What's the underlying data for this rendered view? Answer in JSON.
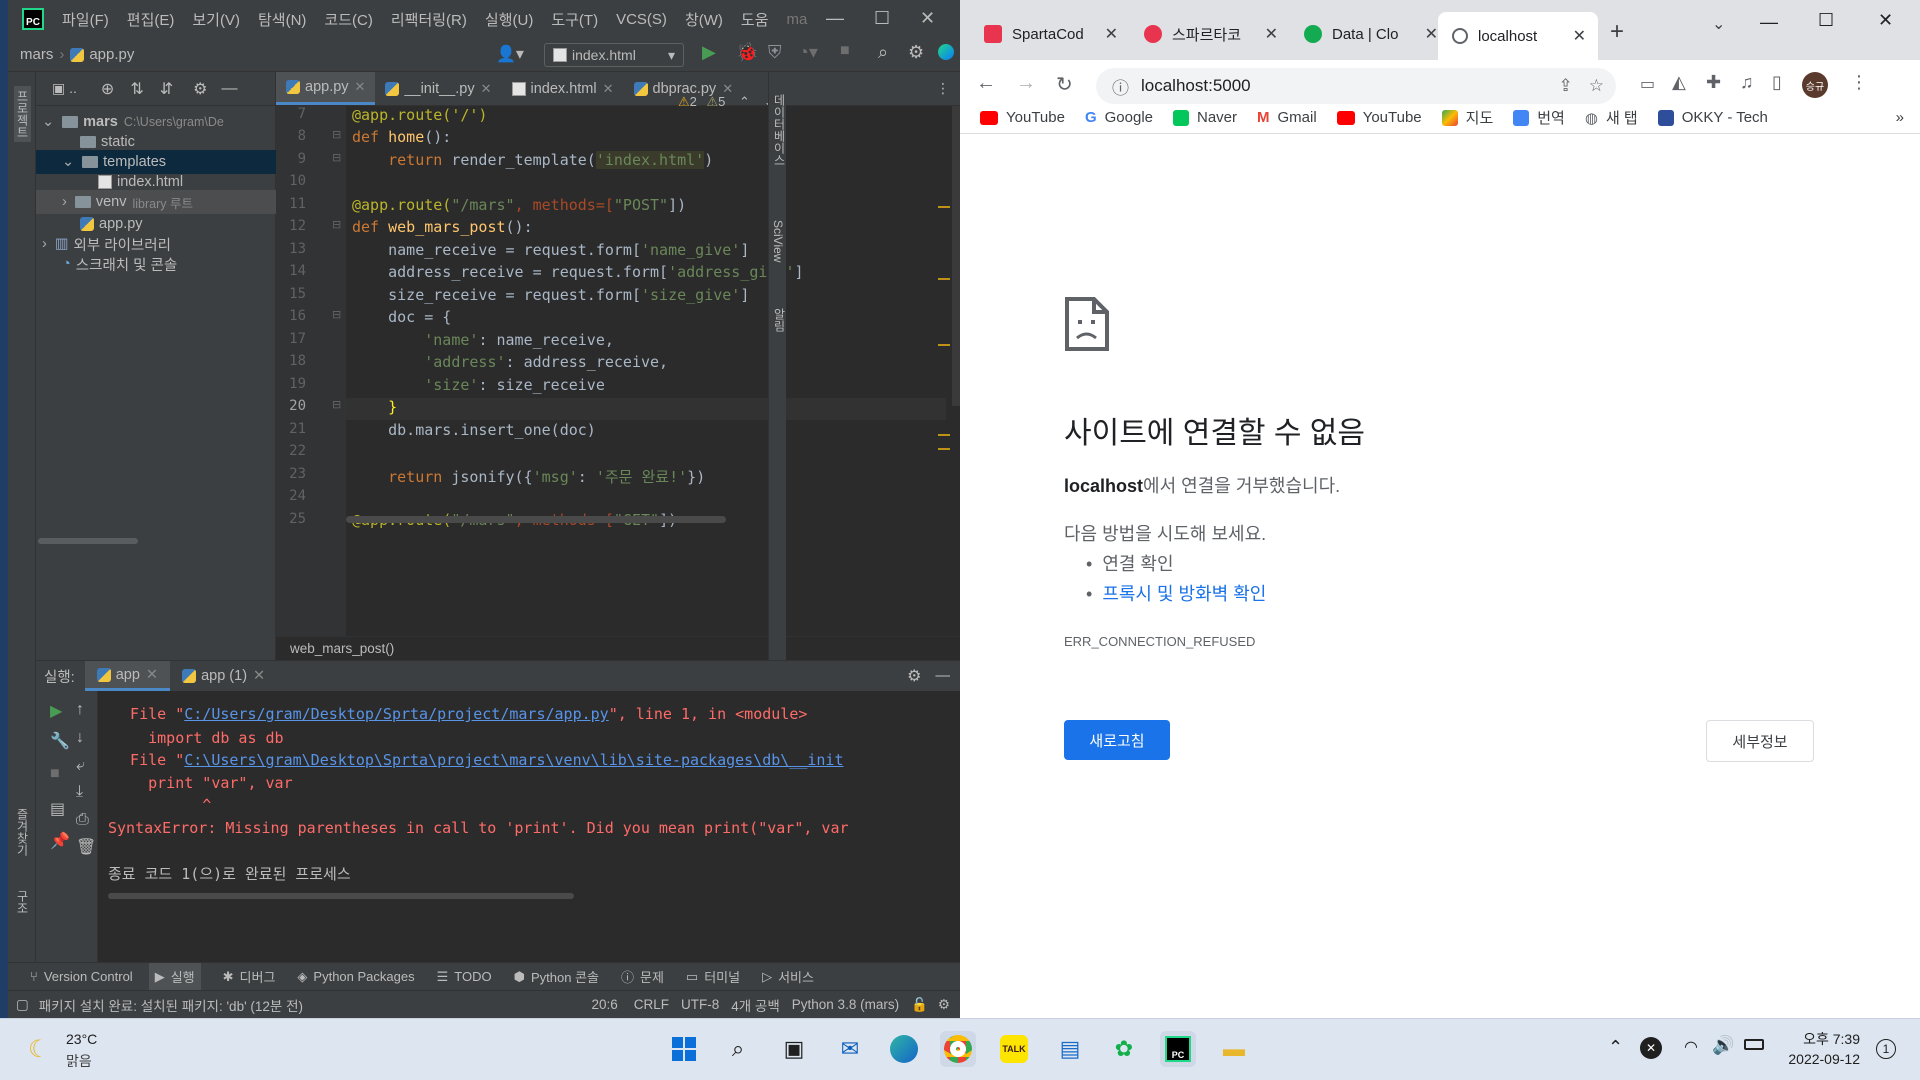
{
  "ide": {
    "menu": [
      "파일(F)",
      "편집(E)",
      "보기(V)",
      "탐색(N)",
      "코드(C)",
      "리팩터링(R)",
      "실행(U)",
      "도구(T)",
      "VCS(S)",
      "창(W)",
      "도움",
      "ma"
    ],
    "nav": {
      "project": "mars",
      "file": "app.py",
      "run_config": "index.html"
    },
    "left_strip_tabs": [
      "프로젝트",
      "구조",
      "즐겨찾기"
    ],
    "right_strip_tabs": [
      "데이터베이스",
      "SciView",
      "알림"
    ],
    "project_tree": [
      {
        "label": "mars",
        "hint": "C:\\Users\\gram\\De"
      },
      {
        "label": "static"
      },
      {
        "label": "templates"
      },
      {
        "label": "index.html"
      },
      {
        "label": "venv",
        "hint": "library 루트"
      },
      {
        "label": "app.py"
      },
      {
        "label": "외부 라이브러리"
      },
      {
        "label": "스크래치 및 콘솔"
      }
    ],
    "editor_tabs": [
      "app.py",
      "__init__.py",
      "index.html",
      "dbprac.py"
    ],
    "inspections": {
      "warnings": "2",
      "weak_warnings": "5"
    },
    "line_numbers": [
      "7",
      "8",
      "9",
      "10",
      "11",
      "12",
      "13",
      "14",
      "15",
      "16",
      "17",
      "18",
      "19",
      "20",
      "21",
      "22",
      "23",
      "24",
      "25"
    ],
    "code": {
      "l7": "@app.route('/')",
      "l8_kw": "def ",
      "l8_fn": "home",
      "l8_rest": "():",
      "l9_kw": "    return ",
      "l9_a": "render_template(",
      "l9_str": "'index.html'",
      "l9_b": ")",
      "l11_dec": "@app.route(",
      "l11_s1": "\"/mars\"",
      "l11_b": ", methods=[",
      "l11_s2": "\"POST\"",
      "l11_c": "])",
      "l12_kw": "def ",
      "l12_fn": "web_mars_post",
      "l12_rest": "():",
      "l13_a": "    name_receive = request.form[",
      "l13_s": "'name_give'",
      "l13_b": "]",
      "l14_a": "    address_receive = request.form[",
      "l14_s": "'address_give'",
      "l14_b": "]",
      "l15_a": "    size_receive = request.form[",
      "l15_s": "'size_give'",
      "l15_b": "]",
      "l16": "    doc = {",
      "l17_s": "        'name'",
      "l17_b": ": name_receive,",
      "l18_s": "        'address'",
      "l18_b": ": address_receive,",
      "l19_s": "        'size'",
      "l19_b": ": size_receive",
      "l20": "    }",
      "l21": "    db.mars.insert_one(doc)",
      "l23_kw": "    return ",
      "l23_a": "jsonify({",
      "l23_s1": "'msg'",
      "l23_b": ": ",
      "l23_s2": "'주문 완료!'",
      "l23_c": "})",
      "l25_dec": "@app.route(",
      "l25_s1": "\"/mars\"",
      "l25_b": ", methods=[",
      "l25_s2": "\"GET\"",
      "l25_c": "])"
    },
    "editor_breadcrumb": "web_mars_post()",
    "run": {
      "label": "실행:",
      "tabs": [
        "app",
        "app (1)"
      ],
      "output": {
        "o1_a": "  File \"",
        "o1_link": "C:/Users/gram/Desktop/Sprta/project/mars/app.py",
        "o1_b": "\", line 1, in <module>",
        "o2": "    import db as db",
        "o3_a": "  File \"",
        "o3_link": "C:\\Users\\gram\\Desktop\\Sprta\\project\\mars\\venv\\lib\\site-packages\\db\\__init",
        "o4": "    print \"var\", var",
        "o5": "          ^",
        "o6": "SyntaxError: Missing parentheses in call to 'print'. Did you mean print(\"var\", var",
        "o7": "종료 코드 1(으)로 완료된 프로세스"
      }
    },
    "tool_tabs": [
      "Version Control",
      "실행",
      "디버그",
      "Python Packages",
      "TODO",
      "Python 콘솔",
      "문제",
      "터미널",
      "서비스"
    ],
    "status": {
      "message": "패키지 설치 완료: 설치된 패키지: 'db' (12분 전)",
      "position": "20:6",
      "line_sep": "CRLF",
      "encoding": "UTF-8",
      "indent": "4개 공백",
      "interpreter": "Python 3.8 (mars)"
    }
  },
  "browser": {
    "tabs": [
      "SpartaCod",
      "스파르타코",
      "Data | Clo",
      "localhost"
    ],
    "url": "localhost:5000",
    "bookmarks": [
      "YouTube",
      "Google",
      "Naver",
      "Gmail",
      "YouTube",
      "지도",
      "번역",
      "새 탭",
      "OKKY - Tech"
    ],
    "error": {
      "title": "사이트에 연결할 수 없음",
      "host": "localhost",
      "host_suffix": "에서 연결을 거부했습니다.",
      "try_label": "다음 방법을 시도해 보세요.",
      "suggestion_1": "연결 확인",
      "suggestion_2": "프록시 및 방화벽 확인",
      "code": "ERR_CONNECTION_REFUSED",
      "reload_button": "새로고침",
      "details_button": "세부정보"
    },
    "avatar_text": "승규"
  },
  "taskbar": {
    "weather_temp": "23°C",
    "weather_desc": "맑음",
    "time": "오후 7:39",
    "date": "2022-09-12",
    "notification_count": "1"
  }
}
